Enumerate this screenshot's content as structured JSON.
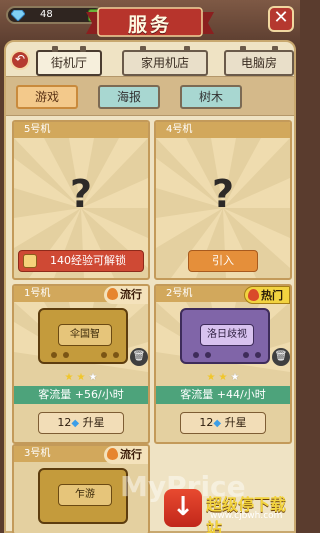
{
  "header": {
    "gems": "48",
    "plus": "+",
    "title": "服务",
    "close": "✕"
  },
  "nav": {
    "back": "↶",
    "tabs": [
      {
        "label": "街机厅",
        "active": true
      },
      {
        "label": "家用机店",
        "active": false
      },
      {
        "label": "电脑房",
        "active": false
      }
    ]
  },
  "subtabs": [
    {
      "label": "游戏",
      "active": true
    },
    {
      "label": "海报",
      "active": false
    },
    {
      "label": "树木",
      "active": false
    }
  ],
  "cards": [
    {
      "number": "5号机",
      "locked": true,
      "qmark": "?",
      "action": "140经验可解锁"
    },
    {
      "number": "4号机",
      "locked": true,
      "qmark": "?",
      "action": "引入"
    },
    {
      "number": "1号机",
      "tag": "流行",
      "machine": "伞国智",
      "stars": 2,
      "max_stars": 3,
      "flow": "客流量 +56/小时",
      "upgrade_cost": "12",
      "upgrade_label": "升星",
      "bin": "🗑"
    },
    {
      "number": "2号机",
      "tag": "热门",
      "machine": "洛日歧视",
      "stars": 2,
      "max_stars": 3,
      "flow": "客流量 +44/小时",
      "upgrade_cost": "12",
      "upgrade_label": "升星",
      "bin": "🗑"
    },
    {
      "number": "3号机",
      "tag": "流行",
      "machine": "乍游"
    }
  ],
  "watermark": "MyPrice",
  "logo": {
    "badge": "↓",
    "brand": "超级停下载站",
    "site": "www.cjbwh.com"
  },
  "colors": {
    "accent": "#cf4934",
    "panel": "#efe3c4",
    "flow_bar": "#4da37b"
  }
}
